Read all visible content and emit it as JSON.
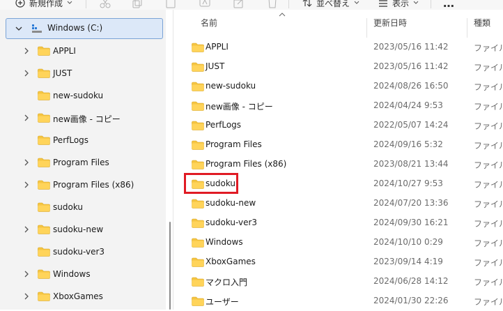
{
  "toolbar": {
    "new_label": "新規作成",
    "sort_label": "並べ替え",
    "view_label": "表示",
    "more_label": "…"
  },
  "nav": {
    "drive": {
      "label": "Windows (C:)",
      "expanded": true,
      "selected": true
    },
    "items": [
      {
        "label": "APPLI",
        "has_children": true
      },
      {
        "label": "JUST",
        "has_children": true
      },
      {
        "label": "new-sudoku",
        "has_children": false
      },
      {
        "label": "new画像 - コピー",
        "has_children": true
      },
      {
        "label": "PerfLogs",
        "has_children": false
      },
      {
        "label": "Program Files",
        "has_children": true
      },
      {
        "label": "Program Files (x86)",
        "has_children": true
      },
      {
        "label": "sudoku",
        "has_children": false
      },
      {
        "label": "sudoku-new",
        "has_children": true
      },
      {
        "label": "sudoku-ver3",
        "has_children": false
      },
      {
        "label": "Windows",
        "has_children": true
      },
      {
        "label": "XboxGames",
        "has_children": true
      }
    ]
  },
  "list": {
    "columns": {
      "name": "名前",
      "date": "更新日時",
      "type": "種類"
    },
    "rows": [
      {
        "name": "APPLI",
        "date": "2023/05/16 11:42",
        "type": "ファイル フ"
      },
      {
        "name": "JUST",
        "date": "2023/05/16 11:42",
        "type": "ファイル フ"
      },
      {
        "name": "new-sudoku",
        "date": "2024/08/26 16:50",
        "type": "ファイル フ"
      },
      {
        "name": "new画像 - コピー",
        "date": "2024/04/24 9:53",
        "type": "ファイル フ"
      },
      {
        "name": "PerfLogs",
        "date": "2022/05/07 14:24",
        "type": "ファイル フ"
      },
      {
        "name": "Program Files",
        "date": "2024/09/16 5:32",
        "type": "ファイル フ"
      },
      {
        "name": "Program Files (x86)",
        "date": "2023/08/21 13:44",
        "type": "ファイル フ"
      },
      {
        "name": "sudoku",
        "date": "2024/10/27 9:53",
        "type": "ファイル フ",
        "highlighted": true
      },
      {
        "name": "sudoku-new",
        "date": "2024/07/20 13:36",
        "type": "ファイル フ"
      },
      {
        "name": "sudoku-ver3",
        "date": "2024/09/30 16:21",
        "type": "ファイル フ"
      },
      {
        "name": "Windows",
        "date": "2024/10/10 0:29",
        "type": "ファイル フ"
      },
      {
        "name": "XboxGames",
        "date": "2023/09/14 4:19",
        "type": "ファイル フ"
      },
      {
        "name": "マクロ入門",
        "date": "2024/06/28 14:12",
        "type": "ファイル フ"
      },
      {
        "name": "ユーザー",
        "date": "2024/01/30 22:26",
        "type": "ファイル フ"
      }
    ]
  },
  "colors": {
    "folder": "#f5c542",
    "highlight": "#e01b24",
    "selection": "#dce8f8"
  }
}
